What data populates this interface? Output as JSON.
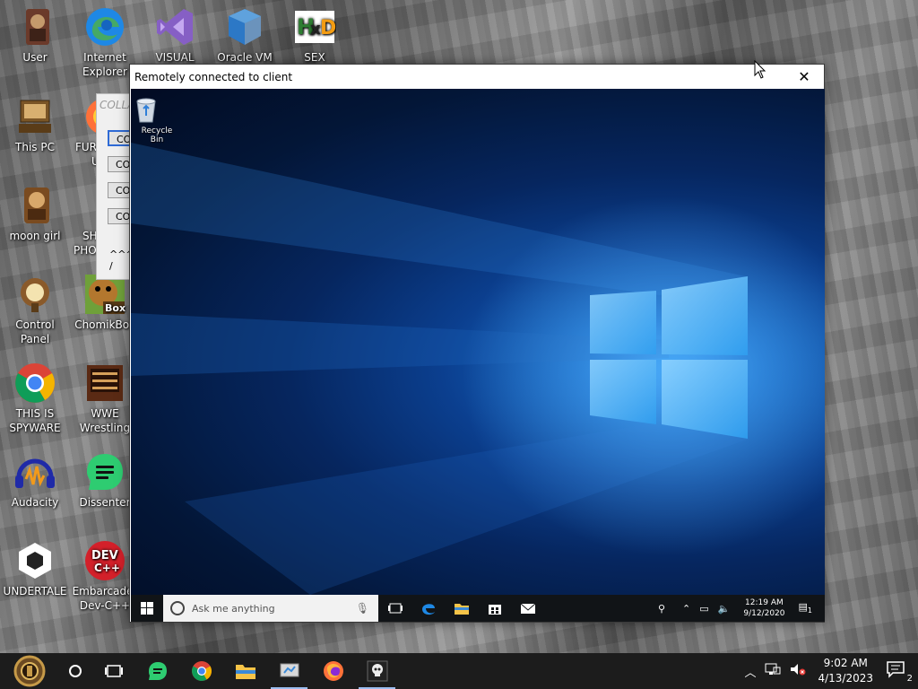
{
  "desktop_icons": [
    {
      "id": "user",
      "label1": "User",
      "label2": "",
      "icon": "user-folder-icon"
    },
    {
      "id": "ie",
      "label1": "Internet",
      "label2": "Explorer",
      "icon": "edge-icon"
    },
    {
      "id": "vs",
      "label1": "VISUAL",
      "label2": "",
      "icon": "visual-studio-icon"
    },
    {
      "id": "vbox",
      "label1": "Oracle VM",
      "label2": "",
      "icon": "virtualbox-icon"
    },
    {
      "id": "hxd",
      "label1": "SEX",
      "label2": "",
      "icon": "hxd-icon"
    },
    {
      "id": "thispc",
      "label1": "This PC",
      "label2": "",
      "icon": "computer-icon"
    },
    {
      "id": "fur",
      "label1": "FUR",
      "label2": "U",
      "icon": "firefox-icon"
    },
    {
      "id": "moon",
      "label1": "moon girl",
      "label2": "",
      "icon": "user-folder-icon"
    },
    {
      "id": "sh",
      "label1": "SH",
      "label2": "PHO",
      "icon": "shortcut-icon"
    },
    {
      "id": "cp",
      "label1": "Control Panel",
      "label2": "",
      "icon": "control-panel-icon"
    },
    {
      "id": "chomik",
      "label1": "ChomikBox",
      "label2": "",
      "icon": "chomikbox-icon"
    },
    {
      "id": "spy",
      "label1": "THIS IS",
      "label2": "SPYWARE",
      "icon": "chrome-icon"
    },
    {
      "id": "wwe",
      "label1": "WWE",
      "label2": "Wrestling",
      "icon": "wwe-icon"
    },
    {
      "id": "aud",
      "label1": "Audacity",
      "label2": "",
      "icon": "audacity-icon"
    },
    {
      "id": "dis",
      "label1": "Dissenter",
      "label2": "",
      "icon": "dissenter-icon"
    },
    {
      "id": "ut",
      "label1": "UNDERTALE",
      "label2": "",
      "icon": "unity-icon"
    },
    {
      "id": "dev",
      "label1": "Embarcader",
      "label2": "Dev-C++",
      "icon": "devcpp-icon"
    }
  ],
  "background_window": {
    "title": "COLLA",
    "buttons": [
      "CO",
      "CO",
      "CO",
      "CO"
    ],
    "footer": "^^^ /"
  },
  "remote_window": {
    "title": "Remotely connected to client",
    "close_label": "✕",
    "recycle_bin_label": "Recycle Bin",
    "search_placeholder": "Ask me anything",
    "clock_time": "12:19 AM",
    "clock_date": "9/12/2020",
    "notifications": "1"
  },
  "taskbar": {
    "clock_time": "9:02 AM",
    "clock_date": "4/13/2023",
    "notifications": "2"
  },
  "colors": {
    "taskbar": "#1c1c1c",
    "remote_taskbar": "#111417",
    "win10_blue": "#1566c2"
  }
}
